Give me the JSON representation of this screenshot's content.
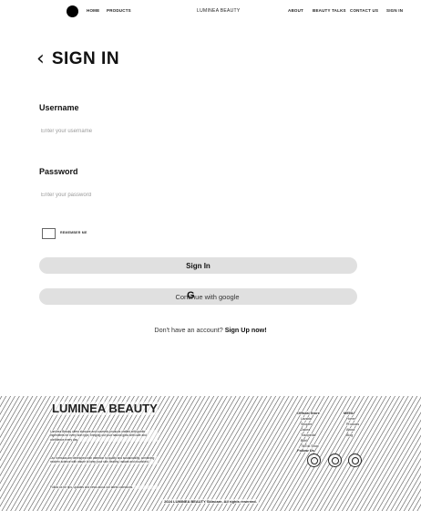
{
  "nav": {
    "home": "HOME",
    "products": "PRODUCTS",
    "brand": "LUMINEA BEAUTY",
    "about": "ABOUT",
    "beauty_talks": "BEAUTY TALKS",
    "contact": "CONTACT US",
    "signin": "SIGN IN"
  },
  "page": {
    "title": "SIGN IN"
  },
  "form": {
    "username_label": "Username",
    "username_placeholder": "Enter your username",
    "password_label": "Password",
    "password_placeholder": "Enter your password",
    "remember_label": "REMEMBER ME",
    "signin_button": "Sign In",
    "google_button": "Continue with google",
    "signup_prompt": "Don't have an account? ",
    "signup_link": "Sign Up now!"
  },
  "footer": {
    "brand": "LUMINEA BEAUTY",
    "para1": "Luminea Beauty offers skincare and cosmetic products crafted with gentle ingredients for every skin type, bringing out your natural glow with care and confidence every day.",
    "para2": "Our formulas are developed with attention to quality and sustainability, combining modern science with nature to keep your skin healthy, radiant and nourished.",
    "para3": "Follow us for tips, updates and news about our latest collections.",
    "official_title": "Official Store",
    "official_items": [
      "Lazada",
      "Shopee",
      "Zalora",
      "Tokopedia",
      "Blibli",
      "TikTok Shop"
    ],
    "menu_title": "MENU",
    "menu_items": [
      "Home",
      "Products",
      "About",
      "Blog"
    ],
    "follow_title": "Follow Us",
    "copyright": "2024 LUMINEA BEAUTY Skincare. All rights reserved."
  }
}
